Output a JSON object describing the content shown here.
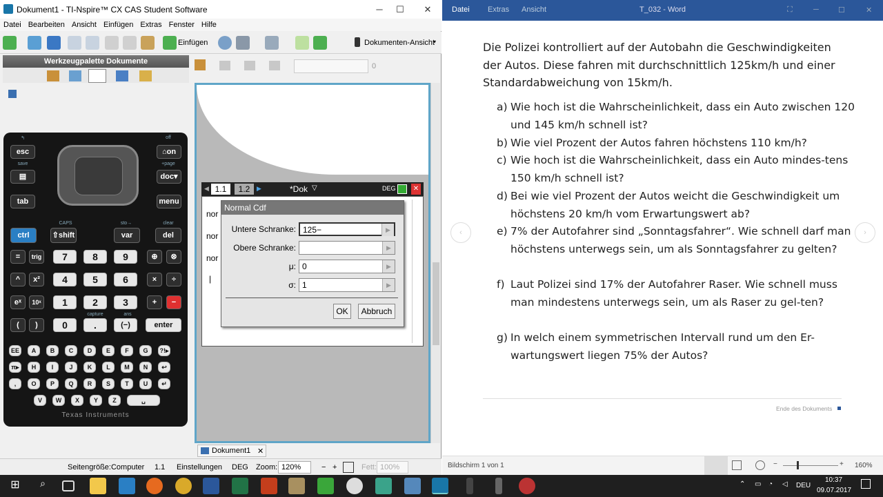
{
  "ti": {
    "title": "Dokument1 - TI-Nspire™ CX CAS Student Software",
    "menu": [
      "Datei",
      "Bearbeiten",
      "Ansicht",
      "Einfügen",
      "Extras",
      "Fenster",
      "Hilfe"
    ],
    "toolbar": {
      "insert_label": "Einfügen",
      "view_label": "Dokumenten-Ansicht",
      "font_size": "0"
    },
    "palette_title": "Werkzeugpalette Dokumente",
    "handheld": {
      "keys_row1": [
        "esc",
        "⌂on"
      ],
      "keys_row2": [
        "doc▾"
      ],
      "keys_row3": [
        "tab",
        "menu"
      ],
      "labels_top": {
        "off": "off",
        "save": "save",
        "page": "+page",
        "caps": "CAPS",
        "sto": "sto→",
        "clear": "clear"
      },
      "ctrl": "ctrl",
      "shift": "⇧shift",
      "var": "var",
      "del": "del",
      "num_rows": [
        [
          "7",
          "8",
          "9"
        ],
        [
          "4",
          "5",
          "6"
        ],
        [
          "1",
          "2",
          "3"
        ]
      ],
      "func_left": [
        [
          "=",
          "trig"
        ],
        [
          "^",
          "x²"
        ],
        [
          "eˣ",
          "10ˣ"
        ],
        [
          "(",
          ")"
        ]
      ],
      "ops": [
        [
          "⊕",
          "⊗"
        ],
        [
          "×",
          "÷"
        ],
        [
          "+",
          "−"
        ]
      ],
      "zero": "0",
      "dot": ".",
      "neg": "(−)",
      "enter": "enter",
      "small_labels": {
        "capture": "capture",
        "ans": "ans",
        "in": "ln",
        "log": "log"
      },
      "alpha_rows": [
        [
          "EE",
          "A",
          "B",
          "C",
          "D",
          "E",
          "F",
          "G",
          "?!▸"
        ],
        [
          "π▸",
          "H",
          "I",
          "J",
          "K",
          "L",
          "M",
          "N",
          "↩"
        ],
        [
          ",",
          "O",
          "P",
          "Q",
          "R",
          "S",
          "T",
          "U",
          "↵"
        ],
        [
          "V",
          "W",
          "X",
          "Y",
          "Z",
          "␣"
        ]
      ],
      "brand": "Texas Instruments"
    },
    "doc_tabs": [
      "1.1",
      "1.2"
    ],
    "doc_name": "*Dok",
    "doc_mode": "DEG",
    "row_labels": [
      "nor",
      "nor",
      "nor"
    ],
    "dialog": {
      "title": "Normal Cdf",
      "fields": [
        {
          "label": "Untere Schranke:",
          "value": "125−"
        },
        {
          "label": "Obere Schranke:",
          "value": ""
        },
        {
          "label": "μ:",
          "value": "0"
        },
        {
          "label": "σ:",
          "value": "1"
        }
      ],
      "ok": "OK",
      "cancel": "Abbruch"
    },
    "doc_tab_bottom": "Dokument1",
    "status": {
      "page_size": "Seitengröße:Computer",
      "page": "1.1",
      "settings": "Einstellungen",
      "angle": "DEG",
      "zoom_label": "Zoom:",
      "zoom": "120%",
      "fett_label": "Fett:",
      "fett": "100%"
    }
  },
  "word": {
    "menu": [
      "Datei",
      "Extras",
      "Ansicht"
    ],
    "title": "T_032  -  Word",
    "intro": "Die Polizei kontrolliert auf der Autobahn die Geschwindigkeiten der Autos. Diese fahren mit durchschnittlich 125km/h und einer Standardabweichung von 15km/h.",
    "questions": [
      {
        "l": "a)",
        "t": "Wie hoch ist die Wahrscheinlichkeit, dass ein Auto zwischen 120 und 145 km/h schnell ist?"
      },
      {
        "l": "b)",
        "t": "Wie viel Prozent der Autos fahren höchstens 110 km/h?"
      },
      {
        "l": "c)",
        "t": "Wie hoch ist die Wahrscheinlichkeit, dass ein Auto mindes-tens 150 km/h schnell ist?"
      },
      {
        "l": "d)",
        "t": "Bei wie viel Prozent der Autos weicht die Geschwindigkeit um höchstens 20 km/h vom Erwartungswert ab?"
      },
      {
        "l": "e)",
        "t": "7% der Autofahrer sind „Sonntagsfahrer“. Wie schnell darf man höchstens unterwegs sein, um als Sonntagsfahrer zu gelten?"
      },
      {
        "l": "f)",
        "t": "Laut Polizei sind 17% der Autofahrer Raser. Wie schnell muss man mindestens unterwegs sein, um als Raser zu gel-ten?"
      },
      {
        "l": "g)",
        "t": "In welch einem symmetrischen Intervall rund um den Er-wartungswert liegen 75% der Autos?"
      }
    ],
    "end_doc": "Ende des Dokuments",
    "status_left": "Bildschirm 1 von 1",
    "zoom": "160%"
  },
  "taskbar": {
    "lang": "DEU",
    "time": "10:37",
    "date": "09.07.2017"
  },
  "colors": {
    "word_blue": "#2b579a",
    "ti_border": "#5fa5c8"
  }
}
